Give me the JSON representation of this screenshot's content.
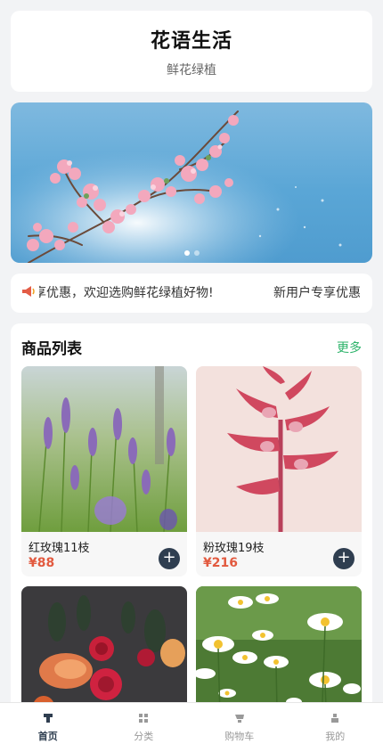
{
  "header": {
    "title": "花语生活",
    "subtitle": "鲜花绿植"
  },
  "banner": {
    "active_dot": 0,
    "dot_count": 2
  },
  "notice": {
    "icon": "megaphone-icon",
    "text_a": "享优惠，欢迎选购鲜花绿植好物!",
    "text_b": "新用户专享优惠"
  },
  "goods": {
    "title": "商品列表",
    "more": "更多",
    "items": [
      {
        "name": "红玫瑰11枝",
        "price": "¥88",
        "add": "+",
        "image": "lavender-field"
      },
      {
        "name": "粉玫瑰19枝",
        "price": "¥216",
        "add": "+",
        "image": "pink-orchid"
      },
      {
        "name": "",
        "price": "",
        "add": "",
        "image": "red-rose-bouquet"
      },
      {
        "name": "",
        "price": "",
        "add": "",
        "image": "white-daisies"
      }
    ]
  },
  "tabbar": {
    "items": [
      {
        "label": "首页",
        "icon": "home-icon",
        "active": true
      },
      {
        "label": "分类",
        "icon": "grid-icon",
        "active": false
      },
      {
        "label": "购物车",
        "icon": "cart-icon",
        "active": false
      },
      {
        "label": "我的",
        "icon": "user-icon",
        "active": false
      }
    ]
  },
  "colors": {
    "accent": "#2f3e50",
    "price": "#e25a3f",
    "more": "#2db36a",
    "background": "#f2f3f5"
  }
}
